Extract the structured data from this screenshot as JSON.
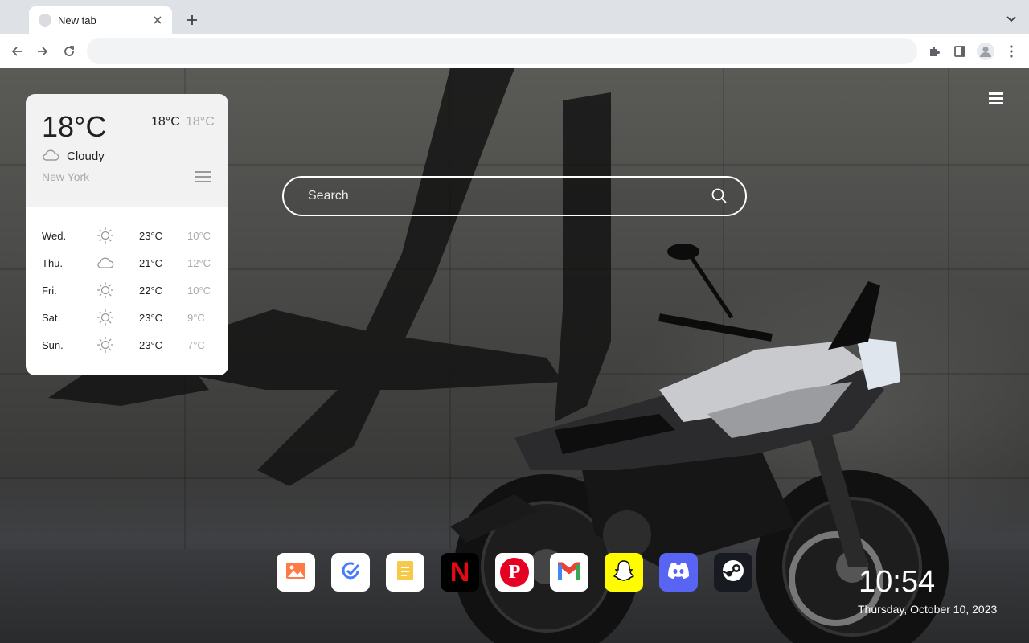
{
  "tabs": [
    {
      "title": "New tab"
    }
  ],
  "omnibox": {
    "value": "",
    "placeholder": ""
  },
  "weather": {
    "current_temp": "18°C",
    "high": "18°C",
    "low": "18°C",
    "condition": "Cloudy",
    "city": "New York",
    "forecast": [
      {
        "day": "Wed.",
        "icon": "sun-icon",
        "high": "23°C",
        "low": "10°C"
      },
      {
        "day": "Thu.",
        "icon": "cloud-icon",
        "high": "21°C",
        "low": "12°C"
      },
      {
        "day": "Fri.",
        "icon": "sun-icon",
        "high": "22°C",
        "low": "10°C"
      },
      {
        "day": "Sat.",
        "icon": "sun-icon",
        "high": "23°C",
        "low": "9°C"
      },
      {
        "day": "Sun.",
        "icon": "sun-icon",
        "high": "23°C",
        "low": "7°C"
      }
    ]
  },
  "search": {
    "placeholder": "Search"
  },
  "dock": [
    {
      "name": "photos",
      "icon": "image-icon",
      "bg": "#ffffff"
    },
    {
      "name": "tasks",
      "icon": "check-icon",
      "bg": "#ffffff"
    },
    {
      "name": "notes",
      "icon": "note-icon",
      "bg": "#ffffff"
    },
    {
      "name": "netflix",
      "icon": "netflix-icon",
      "bg": "#000000",
      "label": "N"
    },
    {
      "name": "pinterest",
      "icon": "pinterest-icon",
      "bg": "#ffffff",
      "label": "P"
    },
    {
      "name": "gmail",
      "icon": "gmail-icon",
      "bg": "#ffffff",
      "label": "M"
    },
    {
      "name": "snapchat",
      "icon": "snapchat-icon",
      "bg": "#fffc00"
    },
    {
      "name": "discord",
      "icon": "discord-icon",
      "bg": "#5865f2"
    },
    {
      "name": "steam",
      "icon": "steam-icon",
      "bg": "#171a21"
    }
  ],
  "clock": {
    "time": "10:54",
    "date": "Thursday, October 10, 2023"
  },
  "colors": {
    "netflix_red": "#e50914",
    "pinterest_red": "#e60023",
    "discord_blurple": "#5865f2",
    "snapchat_yellow": "#fffc00"
  }
}
